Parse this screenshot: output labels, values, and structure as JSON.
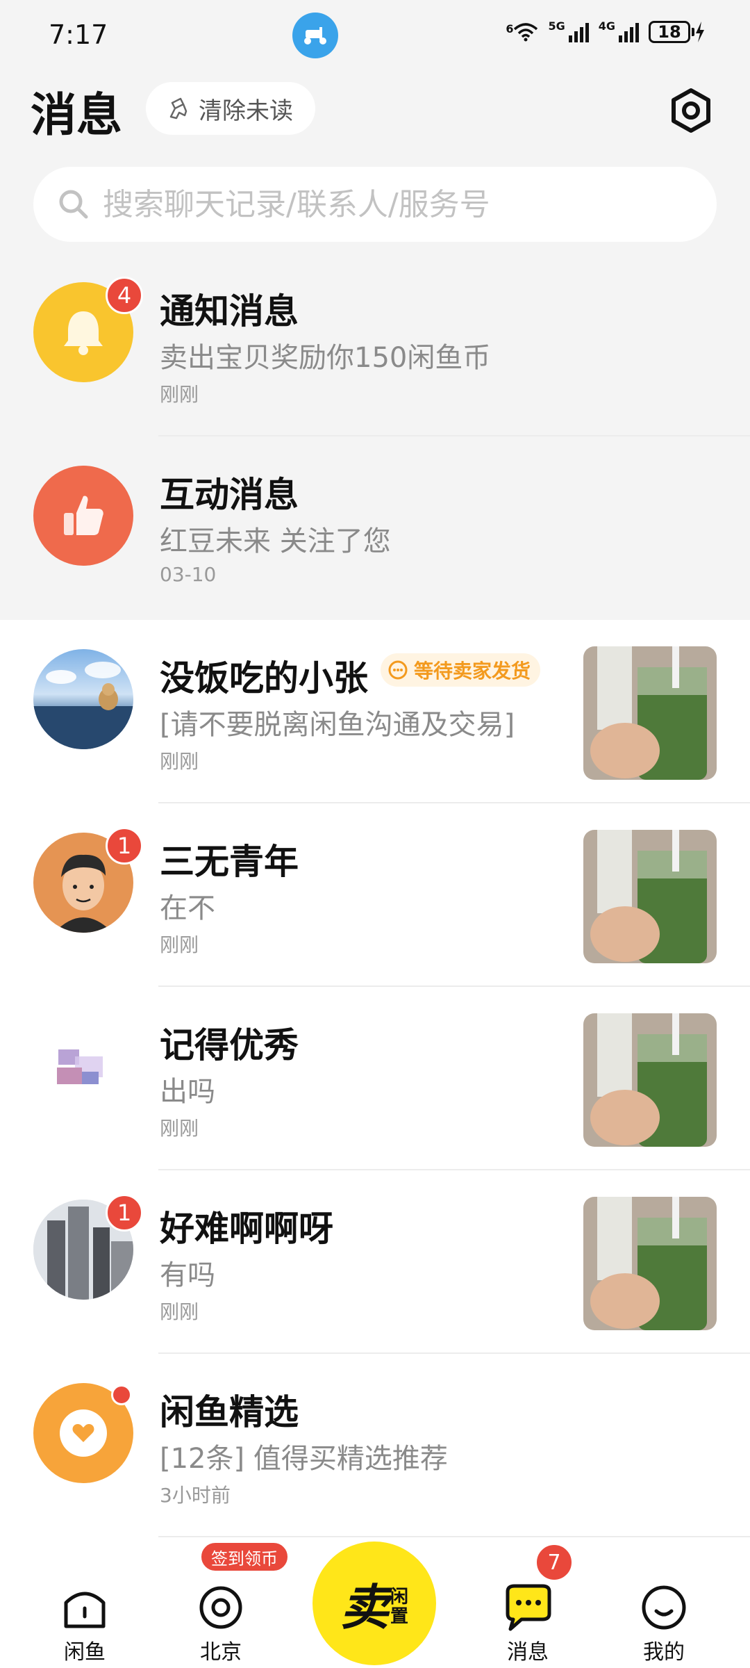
{
  "status_bar": {
    "time": "7:17",
    "signal1": "5G",
    "signal2": "4G",
    "wifi_label": "6",
    "battery": "18"
  },
  "header": {
    "title": "消息",
    "clear_unread": "清除未读"
  },
  "search": {
    "placeholder": "搜索聊天记录/联系人/服务号"
  },
  "rows": [
    {
      "name": "通知消息",
      "message": "卖出宝贝奖励你150闲鱼币",
      "time": "刚刚",
      "badge": "4"
    },
    {
      "name": "互动消息",
      "message": "红豆未来 关注了您",
      "time": "03-10"
    },
    {
      "name": "没饭吃的小张",
      "message": "[请不要脱离闲鱼沟通及交易]",
      "time": "刚刚",
      "tag": "等待卖家发货"
    },
    {
      "name": "三无青年",
      "message": "在不",
      "time": "刚刚",
      "badge": "1"
    },
    {
      "name": "记得优秀",
      "message": "出吗",
      "time": "刚刚"
    },
    {
      "name": "好难啊啊呀",
      "message": "有吗",
      "time": "刚刚",
      "badge": "1"
    },
    {
      "name": "闲鱼精选",
      "message": "[12条] 值得买精选推荐",
      "time": "3小时前"
    }
  ],
  "bottom_nav": {
    "home": "闲鱼",
    "city": "北京",
    "city_chip": "签到领币",
    "sell_main": "卖",
    "sell_sub_1": "闲",
    "sell_sub_2": "置",
    "messages": "消息",
    "messages_badge": "7",
    "mine": "我的"
  },
  "colors": {
    "accent_yellow": "#ffe619",
    "badge_red": "#e9483b",
    "notify_yellow": "#f9c52e",
    "interact_orange": "#ef6a4c",
    "tag_orange": "#f39a1e"
  }
}
